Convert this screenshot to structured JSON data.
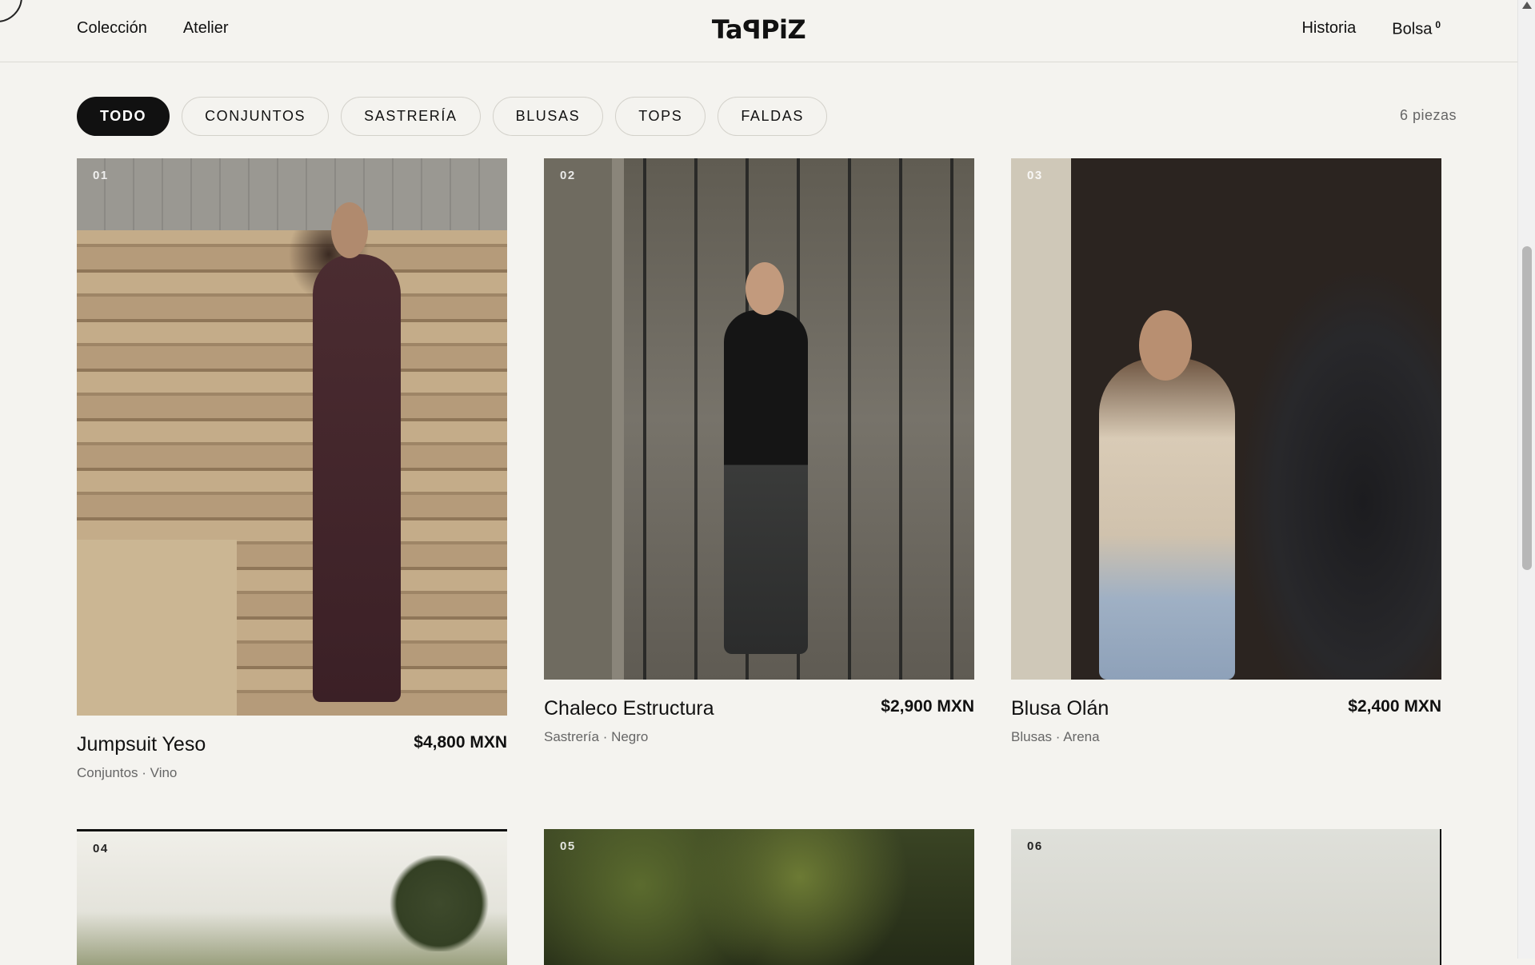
{
  "header": {
    "nav_left": [
      "Colección",
      "Atelier"
    ],
    "logo": "TaꟼPiZ",
    "nav_right": [
      "Historia",
      "Bolsa"
    ],
    "bag_count": "0"
  },
  "filters": {
    "chips": [
      "TODO",
      "CONJUNTOS",
      "SASTRERÍA",
      "BLUSAS",
      "TOPS",
      "FALDAS"
    ],
    "active": "TODO",
    "count_label": "6 piezas"
  },
  "products": [
    {
      "num": "01",
      "name": "Jumpsuit Yeso",
      "price": "$4,800 MXN",
      "meta": "Conjuntos · Vino"
    },
    {
      "num": "02",
      "name": "Chaleco Estructura",
      "price": "$2,900 MXN",
      "meta": "Sastrería · Negro"
    },
    {
      "num": "03",
      "name": "Blusa Olán",
      "price": "$2,400 MXN",
      "meta": "Blusas · Arena"
    },
    {
      "num": "04"
    },
    {
      "num": "05"
    },
    {
      "num": "06"
    }
  ],
  "colors": {
    "background": "#f4f3ef",
    "text": "#111111",
    "muted": "#666666",
    "active_chip": "#111111"
  }
}
